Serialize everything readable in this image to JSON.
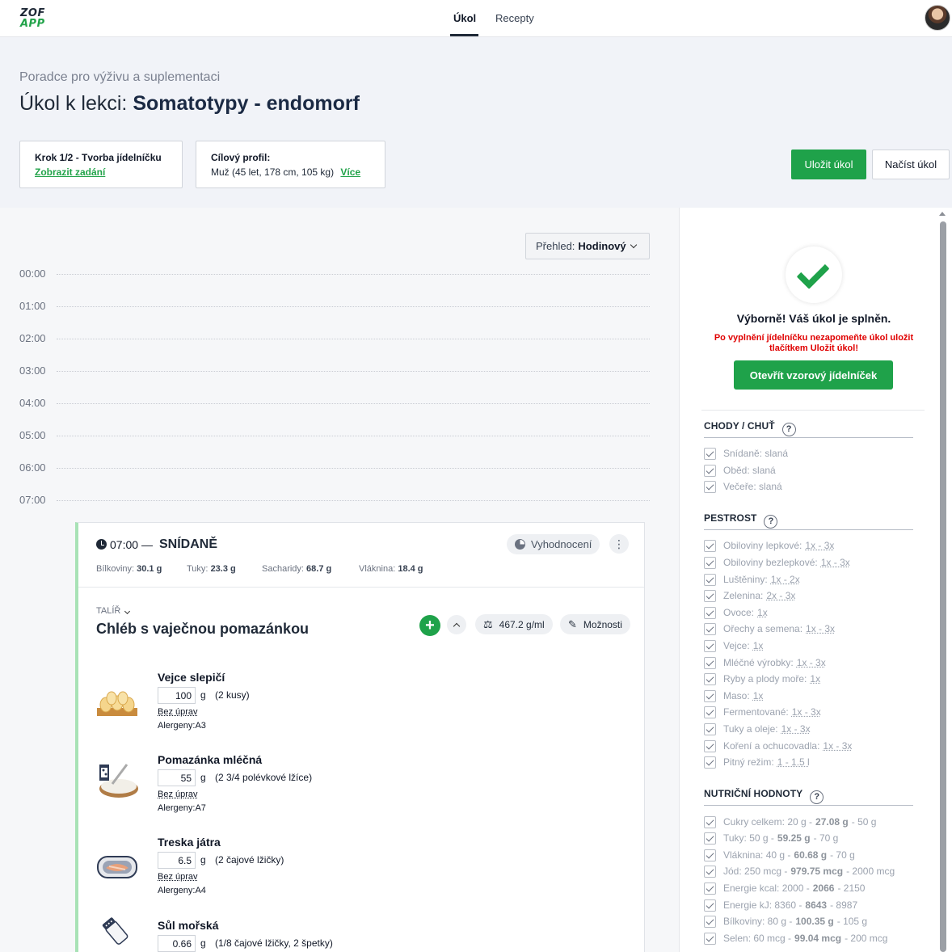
{
  "logo": {
    "line1": "ZOF",
    "line2": "APP"
  },
  "nav": {
    "tabs": [
      {
        "label": "Úkol"
      },
      {
        "label": "Recepty"
      }
    ]
  },
  "header": {
    "subtitle": "Poradce pro výživu a suplementaci",
    "title_prefix": "Úkol k lekci:",
    "title_bold": "Somatotypy - endomorf",
    "step_label": "Krok 1/2 - Tvorba jídelníčku",
    "step_link": "Zobrazit zadání",
    "profile_label": "Cílový profil:",
    "profile_text": "Muž (45 let, 178 cm, 105 kg)",
    "profile_link": "Více",
    "save_button": "Uložit úkol",
    "load_button": "Načíst úkol"
  },
  "overview": {
    "label": "Přehled:",
    "value": "Hodinový"
  },
  "hours": [
    "00:00",
    "01:00",
    "02:00",
    "03:00",
    "04:00",
    "05:00",
    "06:00",
    "07:00"
  ],
  "meal": {
    "time": "07:00",
    "dash": "—",
    "name": "SNÍDANĚ",
    "eval_button": "Vyhodnocení",
    "dots": "⋮",
    "macros": [
      {
        "label": "Bílkoviny:",
        "value": "30.1 g"
      },
      {
        "label": "Tuky:",
        "value": "23.3 g"
      },
      {
        "label": "Sacharidy:",
        "value": "68.7 g"
      },
      {
        "label": "Vláknina:",
        "value": "18.4 g"
      }
    ],
    "plate_label": "TALÍŘ",
    "dish_name": "Chléb s vaječnou pomazánkou",
    "density": "467.2 g/ml",
    "options": "Možnosti",
    "ingredients": [
      {
        "name": "Vejce slepičí",
        "qty": "100",
        "unit": "g",
        "approx": "(2 kusy)",
        "edits": "Bez úprav",
        "allergens": "Alergeny:A3"
      },
      {
        "name": "Pomazánka mléčná",
        "qty": "55",
        "unit": "g",
        "approx": "(2 3/4 polévkové lžíce)",
        "edits": "Bez úprav",
        "allergens": "Alergeny:A7"
      },
      {
        "name": "Treska játra",
        "qty": "6.5",
        "unit": "g",
        "approx": "(2 čajové lžičky)",
        "edits": "Bez úprav",
        "allergens": "Alergeny:A4"
      },
      {
        "name": "Sůl mořská",
        "qty": "0.66",
        "unit": "g",
        "approx": "(1/8 čajové lžičky, 2 špetky)",
        "edits": "",
        "allergens": ""
      }
    ]
  },
  "panel": {
    "success": "Výborně! Váš úkol je splněn.",
    "warning": "Po vyplnění jídelníčku nezapomeňte úkol uložit tlačítkem Uložit úkol!",
    "sample_button": "Otevřít vzorový jídelníček",
    "qmark": "?",
    "sections": [
      {
        "title": "CHODY / CHUŤ",
        "items": [
          {
            "label": "Snídaně: slaná"
          },
          {
            "label": "Oběd: slaná"
          },
          {
            "label": "Večeře: slaná"
          }
        ]
      },
      {
        "title": "PESTROST",
        "items": [
          {
            "label": "Obiloviny lepkové:",
            "range": "1x - 3x"
          },
          {
            "label": "Obiloviny bezlepkové:",
            "range": "1x - 3x"
          },
          {
            "label": "Luštěniny:",
            "range": "1x - 2x"
          },
          {
            "label": "Zelenina:",
            "range": "2x - 3x"
          },
          {
            "label": "Ovoce:",
            "range": "1x"
          },
          {
            "label": "Ořechy a semena:",
            "range": "1x - 3x"
          },
          {
            "label": "Vejce:",
            "range": "1x"
          },
          {
            "label": "Mléčné výrobky:",
            "range": "1x - 3x"
          },
          {
            "label": "Ryby a plody moře:",
            "range": "1x"
          },
          {
            "label": "Maso:",
            "range": "1x"
          },
          {
            "label": "Fermentované:",
            "range": "1x - 3x"
          },
          {
            "label": "Tuky a oleje:",
            "range": "1x - 3x"
          },
          {
            "label": "Koření a ochucovadla:",
            "range": "1x - 3x"
          },
          {
            "label": "Pitný režim:",
            "range": "1 - 1.5 l"
          }
        ]
      },
      {
        "title": "NUTRIČNÍ HODNOTY",
        "items": [
          {
            "label": "Cukry celkem: 20 g -",
            "value": "27.08 g",
            "max": "- 50 g"
          },
          {
            "label": "Tuky: 50 g -",
            "value": "59.25 g",
            "max": "- 70 g"
          },
          {
            "label": "Vláknina: 40 g -",
            "value": "60.68 g",
            "max": "- 70 g"
          },
          {
            "label": "Jód: 250 mcg -",
            "value": "979.75 mcg",
            "max": "- 2000 mcg"
          },
          {
            "label": "Energie kcal: 2000 -",
            "value": "2066",
            "max": "- 2150"
          },
          {
            "label": "Energie kJ: 8360 -",
            "value": "8643",
            "max": "- 8987"
          },
          {
            "label": "Bílkoviny: 80 g -",
            "value": "100.35 g",
            "max": "- 105 g"
          },
          {
            "label": "Selen: 60 mcg -",
            "value": "99.04 mcg",
            "max": "- 200 mcg"
          }
        ]
      }
    ]
  }
}
